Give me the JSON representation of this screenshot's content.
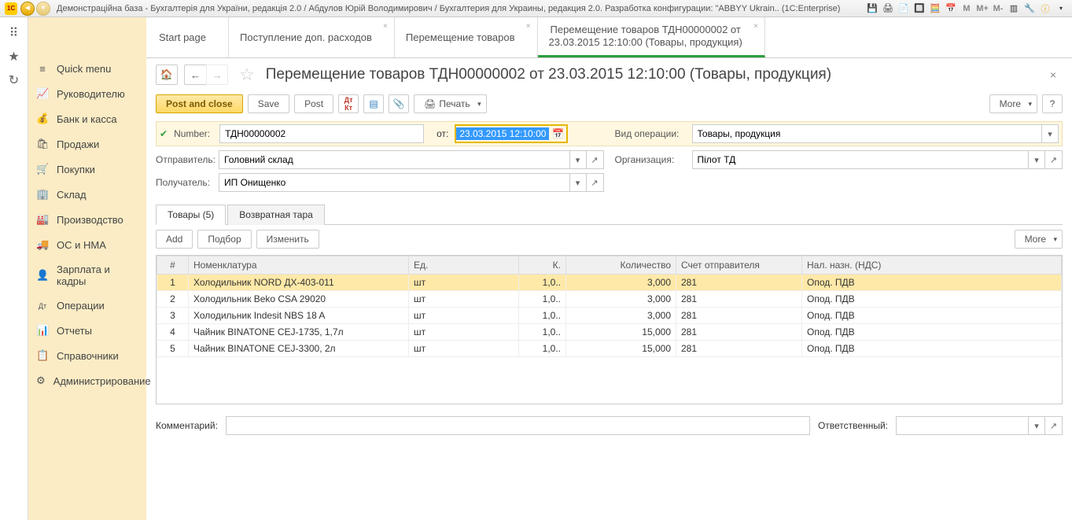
{
  "titlebar": {
    "logo": "1C",
    "title": "Демонстраційна база - Бухгалтерія для України, редакція 2.0 / Абдулов Юрій Володимирович / Бухгалтерия для Украины, редакция 2.0. Разработка конфигурации: \"ABBYY Ukrain.. (1C:Enterprise)",
    "m_buttons": [
      "M",
      "M+",
      "M-"
    ]
  },
  "sidebar": {
    "items": [
      {
        "icon": "≡",
        "label": "Quick menu"
      },
      {
        "icon": "📈",
        "label": "Руководителю"
      },
      {
        "icon": "💰",
        "label": "Банк и касса"
      },
      {
        "icon": "🛍",
        "label": "Продажи"
      },
      {
        "icon": "🛒",
        "label": "Покупки"
      },
      {
        "icon": "🏢",
        "label": "Склад"
      },
      {
        "icon": "🏭",
        "label": "Производство"
      },
      {
        "icon": "🚚",
        "label": "ОС и НМА"
      },
      {
        "icon": "👤",
        "label": "Зарплата и кадры"
      },
      {
        "icon": "Дт",
        "label": "Операции"
      },
      {
        "icon": "📊",
        "label": "Отчеты"
      },
      {
        "icon": "📋",
        "label": "Справочники"
      },
      {
        "icon": "⚙",
        "label": "Администрирование"
      }
    ]
  },
  "tabs": [
    {
      "label": "Start page",
      "closable": false
    },
    {
      "label": "Поступление доп. расходов",
      "closable": true
    },
    {
      "label": "Перемещение товаров",
      "closable": true
    },
    {
      "label_line1": "Перемещение товаров ТДН00000002 от",
      "label_line2": "23.03.2015 12:10:00 (Товары, продукция)",
      "closable": true,
      "active": true
    }
  ],
  "page": {
    "title": "Перемещение товаров ТДН00000002 от 23.03.2015 12:10:00 (Товары, продукция)"
  },
  "toolbar": {
    "post_and_close": "Post and close",
    "save": "Save",
    "post": "Post",
    "print": "Печать",
    "more": "More",
    "help": "?"
  },
  "form": {
    "number_label": "Number:",
    "number": "ТДН00000002",
    "date_label": "от:",
    "date": "23.03.2015 12:10:00",
    "op_type_label": "Вид операции:",
    "op_type": "Товары, продукция",
    "sender_label": "Отправитель:",
    "sender": "Головний склад",
    "org_label": "Организация:",
    "org": "Пілот ТД",
    "receiver_label": "Получатель:",
    "receiver": "ИП Онищенко"
  },
  "subtabs": {
    "goods": "Товары (5)",
    "tara": "Возвратная тара"
  },
  "table_toolbar": {
    "add": "Add",
    "select": "Подбор",
    "edit": "Изменить",
    "more": "More"
  },
  "table": {
    "columns": [
      "#",
      "Номенклатура",
      "Ед.",
      "К.",
      "Количество",
      "Счет отправителя",
      "Нал. назн. (НДС)"
    ],
    "rows": [
      {
        "n": "1",
        "name": "Холодильник NORD ДХ-403-011",
        "unit": "шт",
        "k": "1,0..",
        "qty": "3,000",
        "acc": "281",
        "vat": "Опод. ПДВ"
      },
      {
        "n": "2",
        "name": "Холодильник Beko CSA 29020",
        "unit": "шт",
        "k": "1,0..",
        "qty": "3,000",
        "acc": "281",
        "vat": "Опод. ПДВ"
      },
      {
        "n": "3",
        "name": "Холодильник Indesit NBS 18 A",
        "unit": "шт",
        "k": "1,0..",
        "qty": "3,000",
        "acc": "281",
        "vat": "Опод. ПДВ"
      },
      {
        "n": "4",
        "name": "Чайник BINATONE CEJ-1735,  1,7л",
        "unit": "шт",
        "k": "1,0..",
        "qty": "15,000",
        "acc": "281",
        "vat": "Опод. ПДВ"
      },
      {
        "n": "5",
        "name": "Чайник BINATONE CEJ-3300,  2л",
        "unit": "шт",
        "k": "1,0..",
        "qty": "15,000",
        "acc": "281",
        "vat": "Опод. ПДВ"
      }
    ]
  },
  "footer": {
    "comment_label": "Комментарий:",
    "comment": "",
    "resp_label": "Ответственный:",
    "resp": ""
  }
}
